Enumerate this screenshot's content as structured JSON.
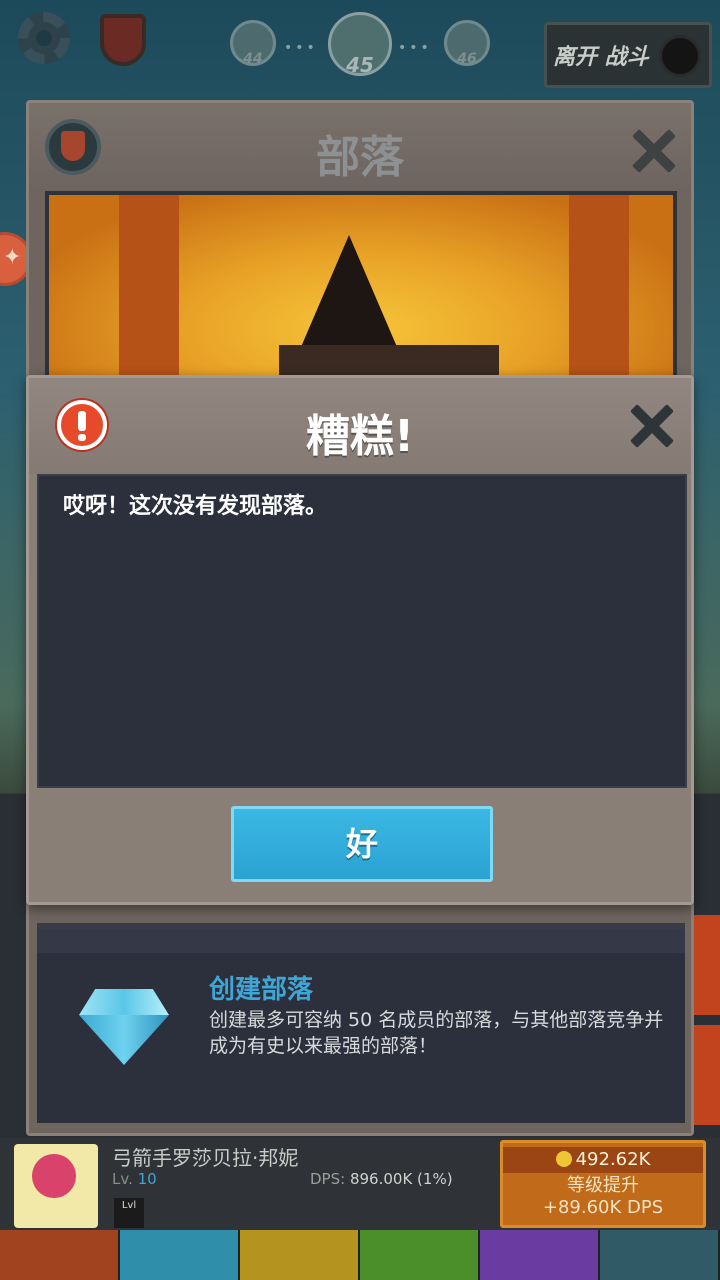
{
  "topbar": {
    "stages": [
      "44",
      "45",
      "46"
    ],
    "leave_battle_label": "离开 战斗"
  },
  "tribe_window": {
    "title": "部落",
    "create": {
      "title": "创建部落",
      "description": "创建最多可容纳 50 名成员的部落，与其他部落竞争并成为有史以来最强的部落！"
    }
  },
  "hero": {
    "name": "弓箭手罗莎贝拉·邦妮",
    "level_prefix": "Lv.",
    "level": "10",
    "lvl_chip": "Lvl",
    "dps_prefix": "DPS:",
    "dps_value": "896.00K (1%)",
    "upgrade_cost": "492.62K",
    "upgrade_label": "等级提升",
    "upgrade_gain": "+89.60K DPS"
  },
  "dialog": {
    "title": "糟糕!",
    "message": "哎呀！这次没有发现部落。",
    "ok_label": "好"
  },
  "colors": {
    "accent_blue": "#3ea6d6",
    "warning_red": "#e64a2a",
    "panel_dark": "#2c2f3c"
  }
}
